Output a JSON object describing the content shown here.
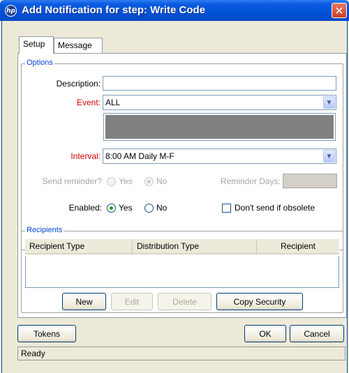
{
  "window": {
    "title": "Add Notification for step: Write Code",
    "logo_text": "hp",
    "close_glyph": "✕"
  },
  "tabs": [
    {
      "label": "Setup",
      "active": true
    },
    {
      "label": "Message",
      "active": false
    }
  ],
  "options": {
    "legend": "Options",
    "description_label": "Description:",
    "description_value": "",
    "event_label": "Event:",
    "event_value": "ALL",
    "interval_label": "Interval:",
    "interval_value": "8:00 AM Daily M-F",
    "send_reminder_label": "Send reminder?",
    "send_reminder_yes": "Yes",
    "send_reminder_no": "No",
    "send_reminder_selected": "No",
    "reminder_days_label": "Reminder Days:",
    "reminder_days_value": "",
    "enabled_label": "Enabled:",
    "enabled_yes": "Yes",
    "enabled_no": "No",
    "enabled_selected": "Yes",
    "dont_send_label": "Don't send if obsolete",
    "dont_send_checked": false
  },
  "recipients": {
    "legend": "Recipients",
    "columns": [
      "Recipient Type",
      "Distribution Type",
      "Recipient"
    ],
    "rows": [],
    "buttons": {
      "new": "New",
      "edit": "Edit",
      "delete": "Delete",
      "copy_security": "Copy Security"
    }
  },
  "footer": {
    "tokens": "Tokens",
    "ok": "OK",
    "cancel": "Cancel"
  },
  "status": {
    "text": "Ready"
  },
  "colors": {
    "title_bar": "#0052d6",
    "required_label": "#d00000",
    "legend_text": "#0046d5",
    "radio_selected": "#21a121"
  },
  "icons": {
    "combo_arrow": "▼"
  }
}
